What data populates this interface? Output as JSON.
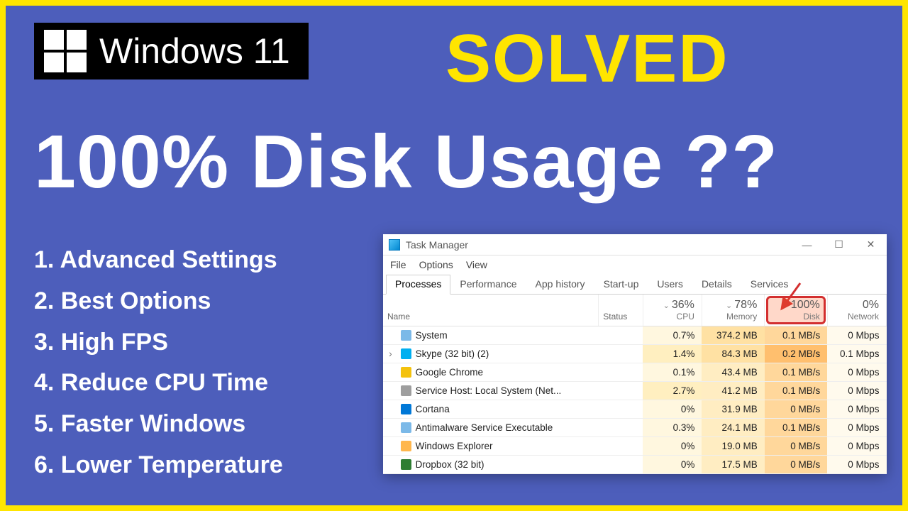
{
  "hero": {
    "windows_label": "Windows 11",
    "solved": "SOLVED",
    "title": "100% Disk Usage ??",
    "bullets": [
      "Advanced Settings",
      "Best Options",
      "High FPS",
      "Reduce CPU Time",
      "Faster Windows",
      "Lower Temperature"
    ]
  },
  "tm": {
    "title": "Task Manager",
    "menu": [
      "File",
      "Options",
      "View"
    ],
    "tabs": [
      "Processes",
      "Performance",
      "App history",
      "Start-up",
      "Users",
      "Details",
      "Services"
    ],
    "active_tab": 0,
    "columns": {
      "name": "Name",
      "status": "Status",
      "cpu_pct": "36%",
      "cpu_label": "CPU",
      "mem_pct": "78%",
      "mem_label": "Memory",
      "disk_pct": "100%",
      "disk_label": "Disk",
      "net_pct": "0%",
      "net_label": "Network"
    },
    "rows": [
      {
        "expand": "",
        "icon": "#7bb9e8",
        "name": "System",
        "cpu": "0.7%",
        "mem": "374.2 MB",
        "disk": "0.1 MB/s",
        "net": "0 Mbps"
      },
      {
        "expand": "›",
        "icon": "#00aff0",
        "name": "Skype (32 bit) (2)",
        "cpu": "1.4%",
        "mem": "84.3 MB",
        "disk": "0.2 MB/s",
        "net": "0.1 Mbps"
      },
      {
        "expand": "",
        "icon": "#f4c20d",
        "name": "Google Chrome",
        "cpu": "0.1%",
        "mem": "43.4 MB",
        "disk": "0.1 MB/s",
        "net": "0 Mbps"
      },
      {
        "expand": "",
        "icon": "#9e9e9e",
        "name": "Service Host: Local System (Net...",
        "cpu": "2.7%",
        "mem": "41.2 MB",
        "disk": "0.1 MB/s",
        "net": "0 Mbps"
      },
      {
        "expand": "",
        "icon": "#0078d7",
        "name": "Cortana",
        "cpu": "0%",
        "mem": "31.9 MB",
        "disk": "0 MB/s",
        "net": "0 Mbps"
      },
      {
        "expand": "",
        "icon": "#7bb9e8",
        "name": "Antimalware Service Executable",
        "cpu": "0.3%",
        "mem": "24.1 MB",
        "disk": "0.1 MB/s",
        "net": "0 Mbps"
      },
      {
        "expand": "",
        "icon": "#ffb74d",
        "name": "Windows Explorer",
        "cpu": "0%",
        "mem": "19.0 MB",
        "disk": "0 MB/s",
        "net": "0 Mbps"
      },
      {
        "expand": "",
        "icon": "#2e7d32",
        "name": "Dropbox (32 bit)",
        "cpu": "0%",
        "mem": "17.5 MB",
        "disk": "0 MB/s",
        "net": "0 Mbps"
      }
    ]
  }
}
